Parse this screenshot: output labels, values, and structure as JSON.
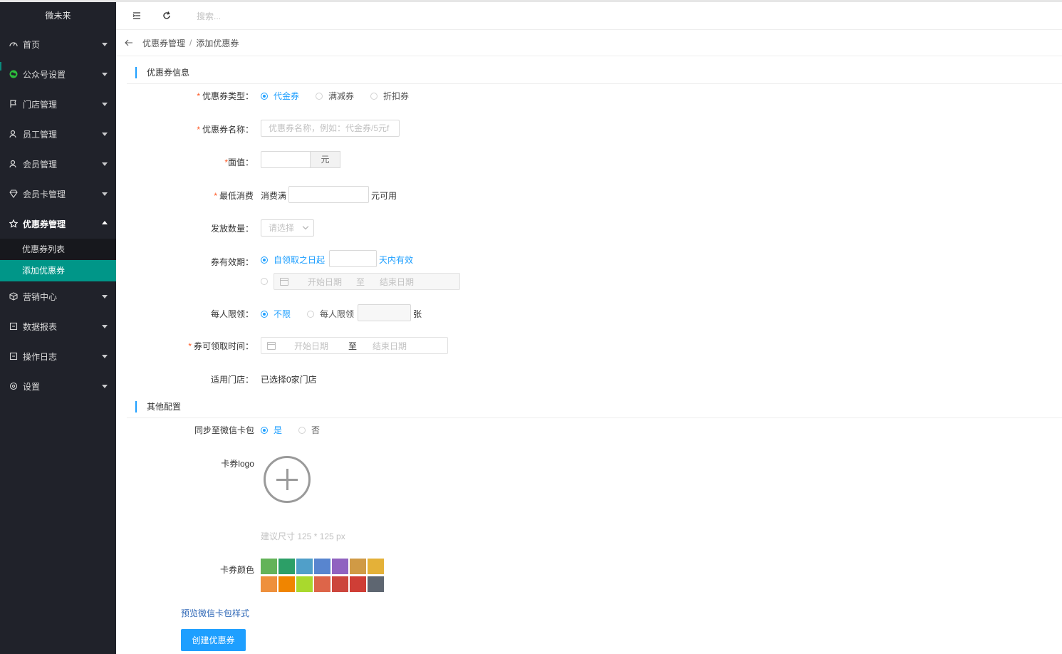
{
  "sidebar": {
    "brand": "微未来",
    "items": [
      {
        "label": "首页",
        "icon": "dashboard-icon"
      },
      {
        "label": "公众号设置",
        "icon": "wechat-icon"
      },
      {
        "label": "门店管理",
        "icon": "flag-icon"
      },
      {
        "label": "员工管理",
        "icon": "user-icon"
      },
      {
        "label": "会员管理",
        "icon": "user-icon"
      },
      {
        "label": "会员卡管理",
        "icon": "diamond-icon"
      },
      {
        "label": "优惠券管理",
        "icon": "star-icon"
      },
      {
        "label": "营销中心",
        "icon": "box-icon"
      },
      {
        "label": "数据报表",
        "icon": "report-icon"
      },
      {
        "label": "操作日志",
        "icon": "log-icon"
      },
      {
        "label": "设置",
        "icon": "settings-icon"
      }
    ],
    "submenu": [
      {
        "label": "优惠券列表"
      },
      {
        "label": "添加优惠券"
      }
    ]
  },
  "header": {
    "search_placeholder": "搜索..."
  },
  "breadcrumb": {
    "parent": "优惠券管理",
    "separator": "/",
    "current": "添加优惠券"
  },
  "form": {
    "section1": "优惠券信息",
    "type_label": "优惠券类型：",
    "type_options": [
      "代金券",
      "满减券",
      "折扣券"
    ],
    "name_label": "优惠券名称：",
    "name_placeholder": "优惠券名称，例如：代金券/5元f",
    "face_label": "面值：",
    "face_unit": "元",
    "min_label": "最低消费",
    "min_prefix": "消费满",
    "min_suffix": "元可用",
    "qty_label": "发放数量：",
    "qty_placeholder": "请选择",
    "valid_label": "券有效期：",
    "valid_opt1_prefix": "自领取之日起",
    "valid_opt1_suffix": "天内有效",
    "start_date": "开始日期",
    "to": "至",
    "end_date": "结束日期",
    "limit_label": "每人限领：",
    "limit_opt1": "不限",
    "limit_opt2": "每人限领",
    "limit_unit": "张",
    "claim_label": "券可领取时间：",
    "store_label": "适用门店：",
    "store_value": "已选择0家门店",
    "section2": "其他配置",
    "sync_label": "同步至微信卡包",
    "sync_yes": "是",
    "sync_no": "否",
    "logo_label": "卡券logo",
    "logo_hint": "建议尺寸 125 * 125 px",
    "color_label": "卡券颜色",
    "colors": [
      "#63b359",
      "#2c9f67",
      "#509fc9",
      "#5885cf",
      "#9062c0",
      "#d09a45",
      "#e4b138",
      "#ee903c",
      "#f08500",
      "#a9d92d",
      "#dd6549",
      "#cc463d",
      "#cf3e36",
      "#5e6671"
    ],
    "preview_link": "预览微信卡包样式",
    "submit": "创建优惠券"
  }
}
